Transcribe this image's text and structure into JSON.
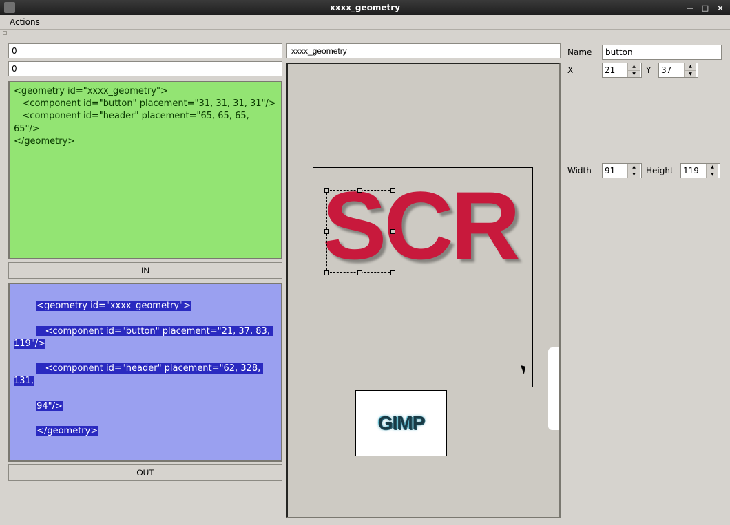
{
  "window": {
    "title": "xxxx_geometry"
  },
  "menu": {
    "actions": "Actions"
  },
  "left": {
    "num1": "0",
    "num2": "0",
    "xml_in": "<geometry id=\"xxxx_geometry\">\n   <component id=\"button\" placement=\"31, 31, 31, 31\"/>\n   <component id=\"header\" placement=\"65, 65, 65, 65\"/>\n</geometry>",
    "in_label": "IN",
    "xml_out_lines": [
      "<geometry id=\"xxxx_geometry\">",
      "   <component id=\"button\" placement=\"21, 37, 83, 119\"/>",
      "   <component id=\"header\" placement=\"62, 328, 131,",
      "94\"/>",
      "</geometry>"
    ],
    "out_label": "OUT"
  },
  "center": {
    "name_field": "xxxx_geometry",
    "scr_text": "SCR",
    "gimp_label": "GIMP"
  },
  "props": {
    "name_label": "Name",
    "name_value": "button",
    "x_label": "X",
    "x_value": "21",
    "y_label": "Y",
    "y_value": "37",
    "width_label": "Width",
    "width_value": "91",
    "height_label": "Height",
    "height_value": "119"
  }
}
